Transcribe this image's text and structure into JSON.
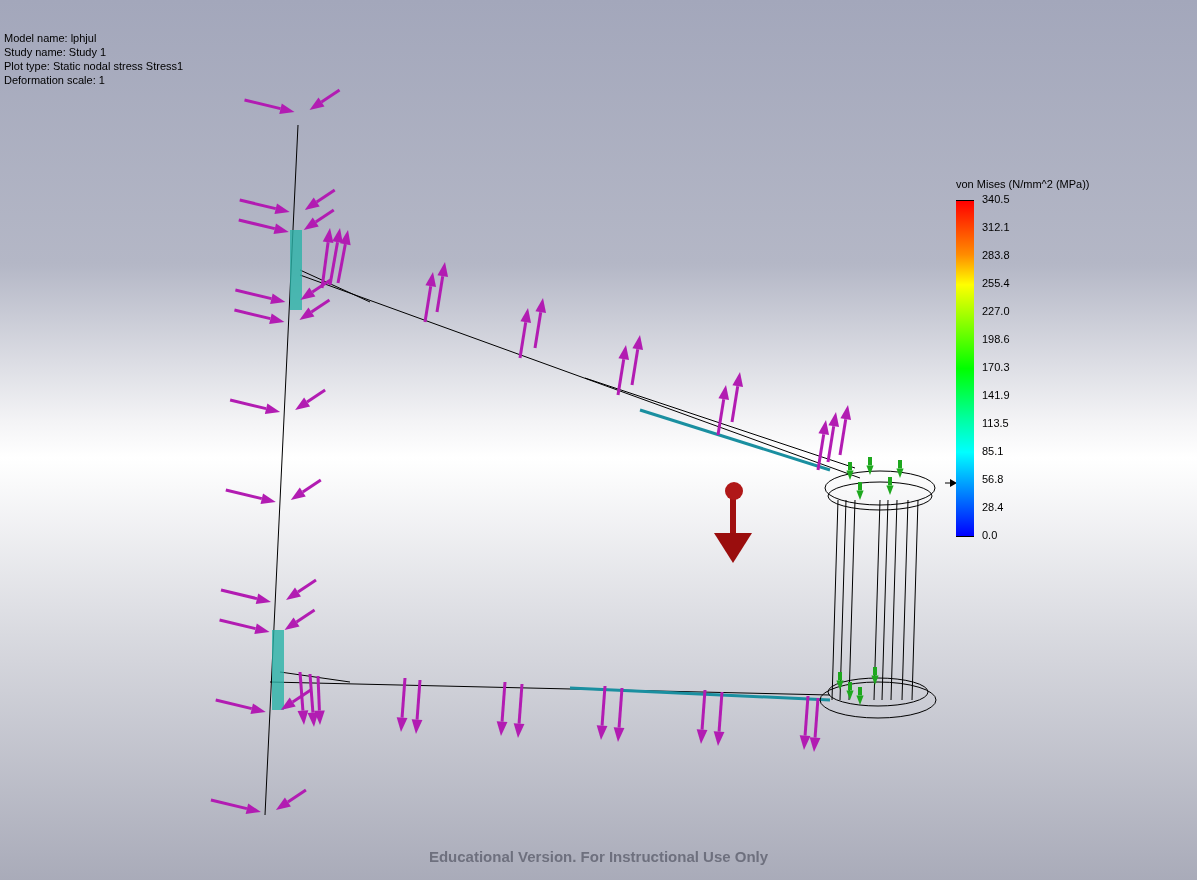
{
  "info": [
    "Model name: lphjul",
    "Study name: Study 1",
    "Plot type: Static nodal stress Stress1",
    "Deformation scale: 1"
  ],
  "legend": {
    "title": "von Mises (N/mm^2 (MPa))",
    "labels": [
      "340.5",
      "312.1",
      "283.8",
      "255.4",
      "227.0",
      "198.6",
      "170.3",
      "141.9",
      "113.5",
      "85.1",
      "56.8",
      "28.4",
      "0.0"
    ]
  },
  "footer": "Educational Version. For Instructional Use Only"
}
